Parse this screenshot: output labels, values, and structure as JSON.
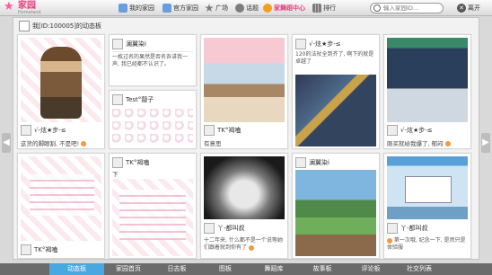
{
  "app": {
    "logo_text": "家园",
    "logo_sub": "Homeland"
  },
  "nav": [
    {
      "label": "我的家园",
      "icon": "home-icon",
      "color": "#6a9de0"
    },
    {
      "label": "官方家园",
      "icon": "official-home-icon",
      "color": "#6a9de0"
    },
    {
      "label": "广场",
      "icon": "plaza-icon",
      "color": "#7d7d7d"
    },
    {
      "label": "话题",
      "icon": "topic-mic-icon",
      "color": "#7d7d7d"
    },
    {
      "label": "家舞蹈中心",
      "icon": "dance-center-icon",
      "color": "#f0a020"
    },
    {
      "label": "排行",
      "icon": "ranking-icon",
      "color": "#7d7d7d"
    }
  ],
  "search": {
    "placeholder": "输入家园ID..."
  },
  "leave": {
    "label": "离开"
  },
  "board": {
    "title": "我[ID:100005]的动态板"
  },
  "cards": [
    {
      "user": "√-炫★步-≤",
      "text": "这货的脚眼割, 不是吧!"
    },
    {
      "user": "澜翼染i",
      "text": "一枚过名的果然是否名各讲我一声, 我已经都不认识了。"
    },
    {
      "user": "Test°靓子",
      "text": ""
    },
    {
      "user": "TK°褐嗑",
      "text": "有意思"
    },
    {
      "user": "√-炫★步-≤",
      "text": "120的法杖全到齐了, 啊下的就是卓越了"
    },
    {
      "user": "√-炫★步-≤",
      "text": "刚买就给我爆了, 郁闷"
    },
    {
      "user": "TK°褐嗑",
      "text": ""
    },
    {
      "user": "TK°褐嗑",
      "text": "下"
    },
    {
      "user": "丫-都叫叔",
      "text": "十二年来, 什么都不是一个说等她们跟着就到你有了"
    },
    {
      "user": "澜翼染i",
      "text": ""
    },
    {
      "user": "丫-都叫叔",
      "text": "第一次哦, 纪念一下, 是然只是体验服"
    }
  ],
  "tabs": [
    "动态板",
    "家园首页",
    "日志板",
    "图板",
    "舞蹈库",
    "故事板",
    "评论板",
    "社交列表"
  ],
  "colors": {
    "accent": "#4aa8e0",
    "brand": "#e8407f",
    "tabbar": "#6b6b6b"
  }
}
